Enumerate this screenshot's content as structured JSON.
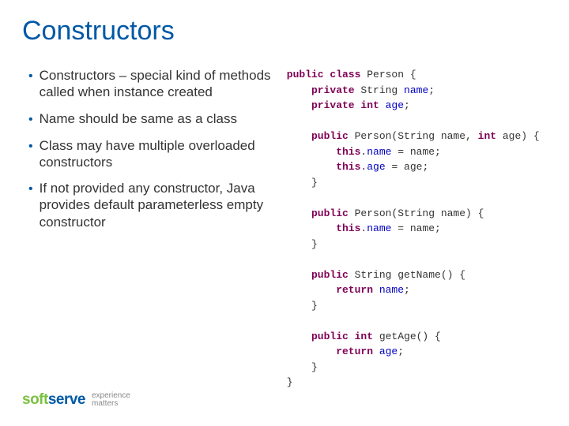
{
  "title": "Constructors",
  "bullets": [
    "Constructors – special kind of methods called when instance created",
    "Name should be same as a class",
    "Class may have multiple overloaded constructors",
    "If not provided any constructor, Java provides default parameterless empty constructor"
  ],
  "code": {
    "line01_a": "public class",
    "line01_b": " Person {",
    "line02_a": "    private",
    "line02_b": " String ",
    "line02_c": "name",
    "line02_d": ";",
    "line03_a": "    private int ",
    "line03_b": "age",
    "line03_c": ";",
    "line04": "",
    "line05_a": "    public",
    "line05_b": " Person(String name, ",
    "line05_c": "int",
    "line05_d": " age) {",
    "line06_a": "        this",
    "line06_b": ".",
    "line06_c": "name",
    "line06_d": " = name;",
    "line07_a": "        this",
    "line07_b": ".",
    "line07_c": "age",
    "line07_d": " = age;",
    "line08": "    }",
    "line09": "",
    "line10_a": "    public",
    "line10_b": " Person(String name) {",
    "line11_a": "        this",
    "line11_b": ".",
    "line11_c": "name",
    "line11_d": " = name;",
    "line12": "    }",
    "line13": "",
    "line14_a": "    public",
    "line14_b": " String getName() {",
    "line15_a": "        return ",
    "line15_b": "name",
    "line15_c": ";",
    "line16": "    }",
    "line17": "",
    "line18_a": "    public int",
    "line18_b": " getAge() {",
    "line19_a": "        return ",
    "line19_b": "age",
    "line19_c": ";",
    "line20": "    }",
    "line21": "}"
  },
  "logo": {
    "part1": "soft",
    "part2": "serve",
    "tag1": "experience",
    "tag2": "matters"
  }
}
